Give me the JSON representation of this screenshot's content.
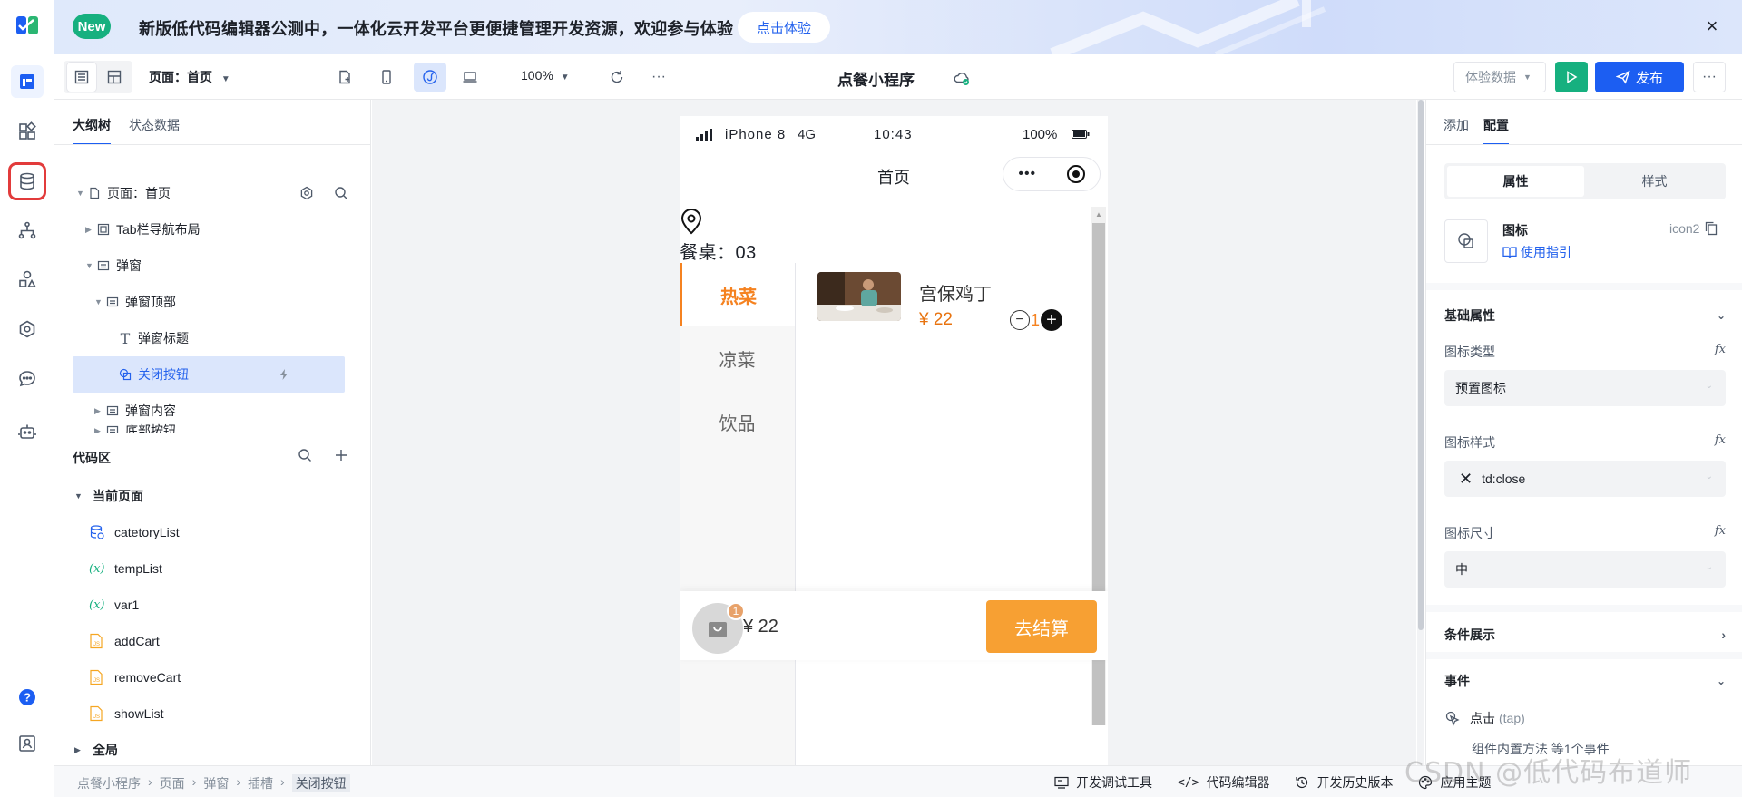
{
  "banner": {
    "badge": "New",
    "message": "新版低代码编辑器公测中，一体化云开发平台更便捷管理开发资源，欢迎参与体验",
    "cta": "点击体验",
    "close": "×"
  },
  "rail": {
    "items": [
      "page-icon",
      "components-icon",
      "database-icon",
      "flow-icon",
      "shapes-icon",
      "settings-hex-icon",
      "chat-icon",
      "robot-icon",
      "help-icon",
      "user-card-icon"
    ]
  },
  "toolbar": {
    "page_selector": "页面：首页",
    "zoom": "100%",
    "more": "···",
    "app_title": "点餐小程序",
    "experience_data": "体验数据",
    "publish": "发布",
    "more_right": "···"
  },
  "left_panel": {
    "tabs": [
      "大纲树",
      "状态数据"
    ],
    "tree": [
      {
        "label": "页面：首页"
      },
      {
        "label": "Tab栏导航布局"
      },
      {
        "label": "弹窗"
      },
      {
        "label": "弹窗顶部"
      },
      {
        "label": "弹窗标题"
      },
      {
        "label": "关闭按钮"
      },
      {
        "label": "弹窗内容"
      },
      {
        "label": "底部按钮"
      }
    ],
    "code_area": {
      "title": "代码区",
      "current_page": "当前页面",
      "items": [
        {
          "icon": "db",
          "label": "catetoryList"
        },
        {
          "icon": "(x)",
          "label": "tempList"
        },
        {
          "icon": "(x)",
          "label": "var1"
        },
        {
          "icon": "js",
          "label": "addCart"
        },
        {
          "icon": "js",
          "label": "removeCart"
        },
        {
          "icon": "js",
          "label": "showList"
        }
      ],
      "global": "全局"
    }
  },
  "phone": {
    "status": {
      "carrier": "iPhone 8",
      "network": "4G",
      "time": "10:43",
      "battery": "100%"
    },
    "nav_title": "首页",
    "capsule_more": "•••",
    "table_no": "餐桌：03",
    "categories": [
      "热菜",
      "凉菜",
      "饮品"
    ],
    "dish": {
      "name": "宫保鸡丁",
      "price": "¥ 22",
      "qty": "1"
    },
    "cart": {
      "badge": "1",
      "total": "¥ 22",
      "checkout": "去结算"
    }
  },
  "right_panel": {
    "tabs": [
      "添加",
      "配置"
    ],
    "segments": [
      "属性",
      "样式"
    ],
    "component": {
      "name": "图标",
      "guide": "使用指引",
      "id": "icon2"
    },
    "basic_title": "基础属性",
    "props": [
      {
        "label": "图标类型",
        "value": "预置图标",
        "fx": "fx"
      },
      {
        "label": "图标样式",
        "value": "td:close",
        "fx": "fx"
      },
      {
        "label": "图标尺寸",
        "value": "中",
        "fx": "fx"
      }
    ],
    "cond_title": "条件展示",
    "events_title": "事件",
    "event": {
      "name": "点击",
      "type": "(tap)",
      "sub": "组件内置方法 等1个事件"
    }
  },
  "footer": {
    "crumbs": [
      "点餐小程序",
      "页面",
      "弹窗",
      "插槽",
      "关闭按钮"
    ],
    "tools": [
      "开发调试工具",
      "代码编辑器",
      "开发历史版本",
      "应用主题"
    ]
  },
  "watermark": "CSDN @低代码布道师",
  "colors": {
    "primary": "#1c5ef2",
    "accent_orange": "#f58220",
    "run_green": "#16b07f",
    "highlight_red": "#e23b3b"
  }
}
